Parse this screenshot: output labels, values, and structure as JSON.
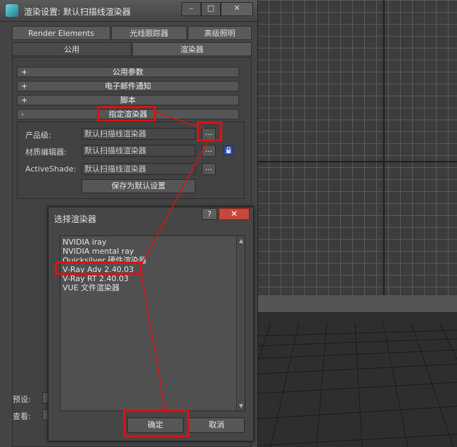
{
  "window": {
    "title": "渲染设置: 默认扫描线渲染器",
    "minimize": "–",
    "maximize": "□",
    "close": "✕"
  },
  "tabs": {
    "row1": [
      "Render Elements",
      "光线跟踪器",
      "高级照明"
    ],
    "row2": [
      "公用",
      "渲染器"
    ]
  },
  "rollouts": [
    {
      "sign": "+",
      "label": "公用参数"
    },
    {
      "sign": "+",
      "label": "电子邮件通知"
    },
    {
      "sign": "+",
      "label": "脚本"
    },
    {
      "sign": "-",
      "label": "指定渲染器"
    }
  ],
  "assign": {
    "production_label": "产品级:",
    "production_value": "默认扫描线渲染器",
    "material_label": "材质编辑器:",
    "material_value": "默认扫描线渲染器",
    "activeshade_label": "ActiveShade:",
    "activeshade_value": "默认扫描线渲染器",
    "browse": "...",
    "save_default": "保存为默认设置"
  },
  "bottom": {
    "preset_label": "预设:",
    "view_label": "查看:"
  },
  "dialog": {
    "title": "选择渲染器",
    "help": "?",
    "close": "✕",
    "items": [
      "NVIDIA iray",
      "NVIDIA mental ray",
      "Quicksilver 硬件渲染器",
      "V-Ray Adv 2.40.03",
      "V-Ray RT 2.40.03",
      "VUE 文件渲染器"
    ],
    "ok": "确定",
    "cancel": "取消"
  },
  "colors": {
    "highlight": "#dd1111",
    "lock_button": "#2f4fae",
    "dialog_close": "#c9463d"
  }
}
